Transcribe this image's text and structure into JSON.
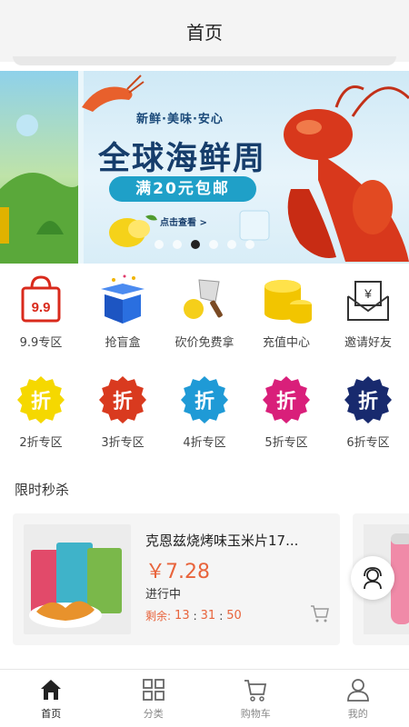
{
  "header": {
    "title": "首页"
  },
  "banner": {
    "tagline": "新鲜·美味·安心",
    "headline": "全球海鲜周",
    "promo": "满20元包邮",
    "cta": "点击查看 >",
    "slide_count": 6,
    "active_slide": 3
  },
  "quick_menu": [
    {
      "label": "9.9专区",
      "icon": "shopping-bag-icon",
      "text": "9.9"
    },
    {
      "label": "抢盲盒",
      "icon": "blind-box-icon"
    },
    {
      "label": "砍价免费拿",
      "icon": "cleaver-icon"
    },
    {
      "label": "充值中心",
      "icon": "gold-coins-icon"
    },
    {
      "label": "邀请好友",
      "icon": "envelope-yen-icon",
      "text": "¥"
    }
  ],
  "discount_zones": [
    {
      "label": "2折专区",
      "badge": "折",
      "color": "#f5d800"
    },
    {
      "label": "3折专区",
      "badge": "折",
      "color": "#d93a1f"
    },
    {
      "label": "4折专区",
      "badge": "折",
      "color": "#1f9ad6"
    },
    {
      "label": "5折专区",
      "badge": "折",
      "color": "#d91f7a"
    },
    {
      "label": "6折专区",
      "badge": "折",
      "color": "#182a6e"
    }
  ],
  "flash_sale": {
    "title": "限时秒杀",
    "products": [
      {
        "name": "克恩兹烧烤味玉米片17...",
        "price": "￥7.28",
        "status": "进行中",
        "remaining_label": "剩余:",
        "hours": "13",
        "minutes": "31",
        "seconds": "50"
      }
    ]
  },
  "tabbar": {
    "tabs": [
      {
        "label": "首页",
        "icon": "home-icon",
        "active": true
      },
      {
        "label": "分类",
        "icon": "category-grid-icon",
        "active": false
      },
      {
        "label": "购物车",
        "icon": "cart-icon",
        "active": false
      },
      {
        "label": "我的",
        "icon": "user-icon",
        "active": false
      }
    ]
  },
  "colors": {
    "accent_price": "#e8643c",
    "promo_bar": "#1fa0c8",
    "active_tab": "#222222"
  }
}
